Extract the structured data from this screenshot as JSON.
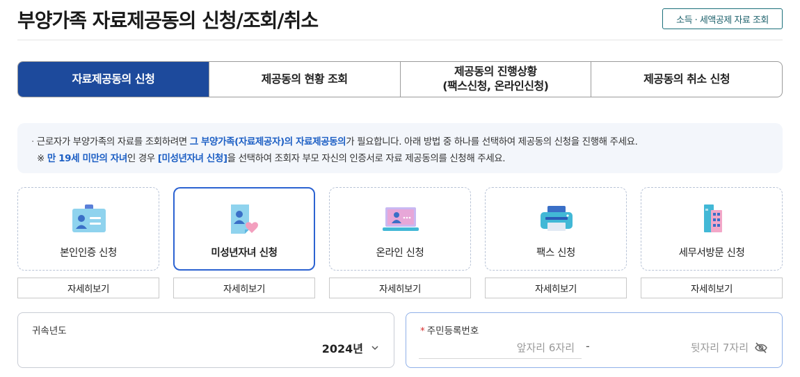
{
  "header": {
    "title": "부양가족 자료제공동의 신청/조회/취소",
    "link_label": "소득 · 세액공제 자료 조회"
  },
  "tabs": [
    {
      "label": "자료제공동의 신청",
      "active": true
    },
    {
      "label": "제공동의 현황 조회",
      "active": false
    },
    {
      "label": "제공동의 진행상황\n(팩스신청, 온라인신청)",
      "active": false
    },
    {
      "label": "제공동의 취소 신청",
      "active": false
    }
  ],
  "notice": {
    "line1": {
      "bullet": "·",
      "pre": " 근로자가 부양가족의 자료를 조회하려면 ",
      "highlight": "그 부양가족(자료제공자)의 자료제공동의",
      "post": "가 필요합니다. 아래 방법 중 하나를 선택하여 제공동의 신청을 진행해 주세요."
    },
    "line2": {
      "prefix": "※ ",
      "highlight1": "만 19세 미만의 자녀",
      "mid": "인 경우 ",
      "highlight2": "[미성년자녀 신청]",
      "post": "을 선택하여 조회자 부모 자신의 인증서로 자료 제공동의를 신청해 주세요."
    }
  },
  "methods": [
    {
      "label": "본인인증 신청",
      "icon": "id-card-icon",
      "selected": false,
      "detail_label": "자세히보기"
    },
    {
      "label": "미성년자녀 신청",
      "icon": "child-document-heart-icon",
      "selected": true,
      "detail_label": "자세히보기"
    },
    {
      "label": "온라인 신청",
      "icon": "laptop-icon",
      "selected": false,
      "detail_label": "자세히보기"
    },
    {
      "label": "팩스 신청",
      "icon": "fax-printer-icon",
      "selected": false,
      "detail_label": "자세히보기"
    },
    {
      "label": "세무서방문 신청",
      "icon": "tax-office-building-icon",
      "selected": false,
      "detail_label": "자세히보기"
    }
  ],
  "form": {
    "year": {
      "label": "귀속년도",
      "value": "2024년"
    },
    "ssn": {
      "required_mark": "*",
      "label": "주민등록번호",
      "front_placeholder": "앞자리 6자리",
      "separator": "-",
      "back_placeholder": "뒷자리 7자리"
    }
  },
  "colors": {
    "primary": "#1d4a9c",
    "highlight": "#1d5fc4",
    "selected_border": "#2b62d1",
    "teal_border": "#1a6f7a"
  }
}
